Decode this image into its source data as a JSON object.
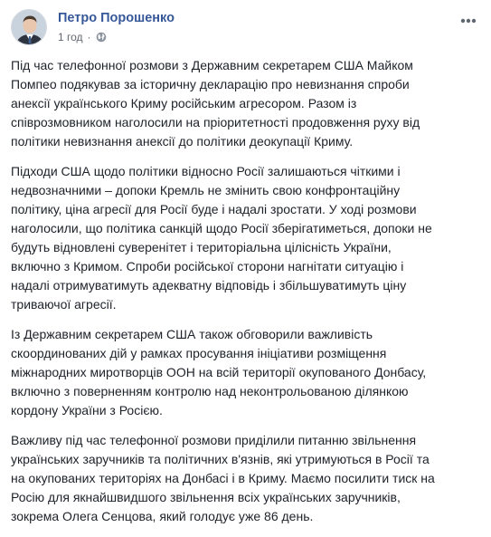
{
  "post": {
    "author": "Петро Порошенко",
    "timestamp": "1 год",
    "separator": "·",
    "privacy_icon": "globe-icon",
    "options_icon": "more-options-icon",
    "link_color": "#365899",
    "text_color": "#1d2129",
    "paragraphs": [
      "Під час телефонної розмови з Державним секретарем США Майком\nПомпео подякував за історичну декларацію про невизнання спроби\nанексії українського Криму російським агресором. Разом із\nспіврозмовником наголосили на пріоритетності продовження руху від\nполітики невизнання анексії до політики деокупації Криму.",
      "Підходи США щодо політики відносно Росії залишаються чіткими і\nнедвозначними – допоки Кремль не змінить свою конфронтаційну\nполітику, ціна агресії для Росії буде і надалі зростати. У ході розмови\nнаголосили, що політика санкцій щодо Росії зберігатиметься, допоки не\nбудуть відновлені суверенітет і територіальна цілісність України,\nвключно з Кримом. Спроби російської сторони нагнітати ситуацію і\nнадалі отримуватимуть адекватну відповідь і збільшуватимуть ціну\nтриваючої агресії.",
      "Із Державним секретарем США також обговорили важливість\nскоординованих дій у рамках просування ініціативи розміщення\nміжнародних миротворців ООН на всій території окупованого Донбасу,\nвключно з поверненням контролю над неконтрольованою ділянкою\nкордону України з Росією.",
      "Важливу під час телефонної розмови приділили питанню звільнення\nукраїнських заручників та політичних в'язнів, які утримуються в Росії та\nна окупованих територіях на Донбасі і в Криму. Маємо посилити тиск на\nРосію для якнайшвидшого звільнення всіх українських заручників,\nзокрема Олега Сенцова, який голодує уже 86 день."
    ]
  }
}
